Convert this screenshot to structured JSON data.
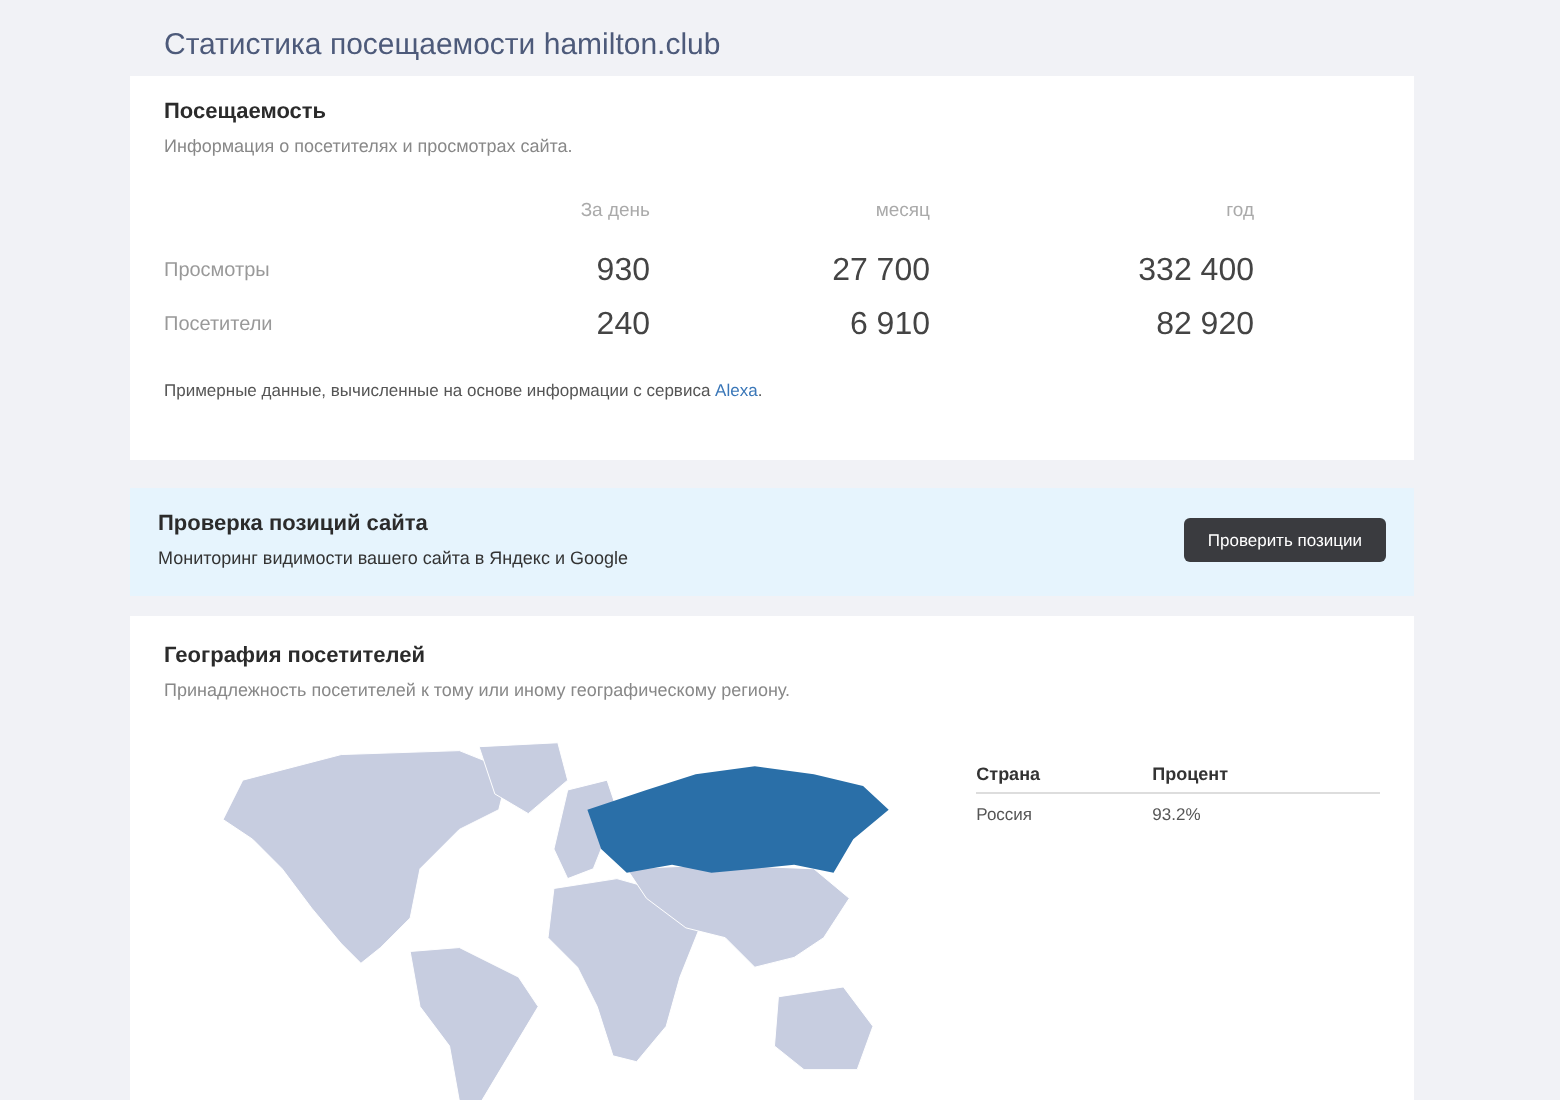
{
  "page_title": "Статистика посещаемости hamilton.club",
  "attendance": {
    "title": "Посещаемость",
    "subtitle": "Информация о посетителях и просмотрах сайта.",
    "columns": [
      "За день",
      "месяц",
      "год"
    ],
    "rows": [
      {
        "label": "Просмотры",
        "values": [
          "930",
          "27 700",
          "332 400"
        ]
      },
      {
        "label": "Посетители",
        "values": [
          "240",
          "6 910",
          "82 920"
        ]
      }
    ],
    "note": "Примерные данные, вычисленные на основе информации с сервиса ",
    "note_link": "Alexa",
    "note_end": "."
  },
  "promo": {
    "title": "Проверка позиций сайта",
    "subtitle": "Мониторинг видимости вашего сайта в Яндекс и Google",
    "button": "Проверить позиции"
  },
  "geography": {
    "title": "География посетителей",
    "subtitle": "Принадлежность посетителей к тому или иному географическому региону.",
    "columns": [
      "Страна",
      "Процент"
    ],
    "rows": [
      {
        "country": "Россия",
        "percent": "93.2%",
        "color": "#2a6fa8"
      }
    ]
  }
}
